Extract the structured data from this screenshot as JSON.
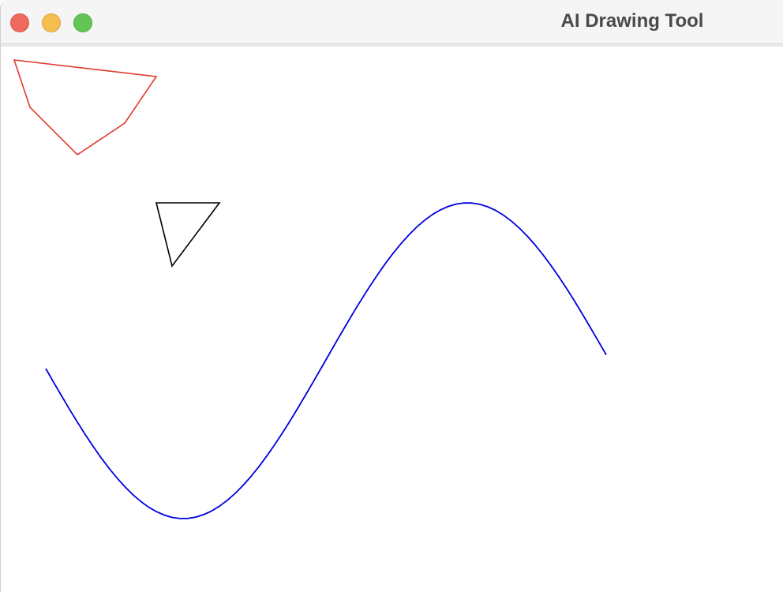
{
  "window": {
    "title": "AI Drawing Tool"
  },
  "titlebar": {
    "buttons": [
      {
        "name": "close",
        "color": "#ee6a5e"
      },
      {
        "name": "minimize",
        "color": "#f5be4f"
      },
      {
        "name": "zoom",
        "color": "#62c554"
      }
    ]
  },
  "canvas": {
    "background": "#ffffff",
    "shapes": [
      {
        "kind": "polygon",
        "name": "pentagon",
        "stroke": "#e0392b"
      },
      {
        "kind": "polygon",
        "name": "triangle",
        "stroke": "#000000"
      },
      {
        "kind": "polyline",
        "name": "sine-wave",
        "stroke": "#0000e0"
      }
    ]
  }
}
